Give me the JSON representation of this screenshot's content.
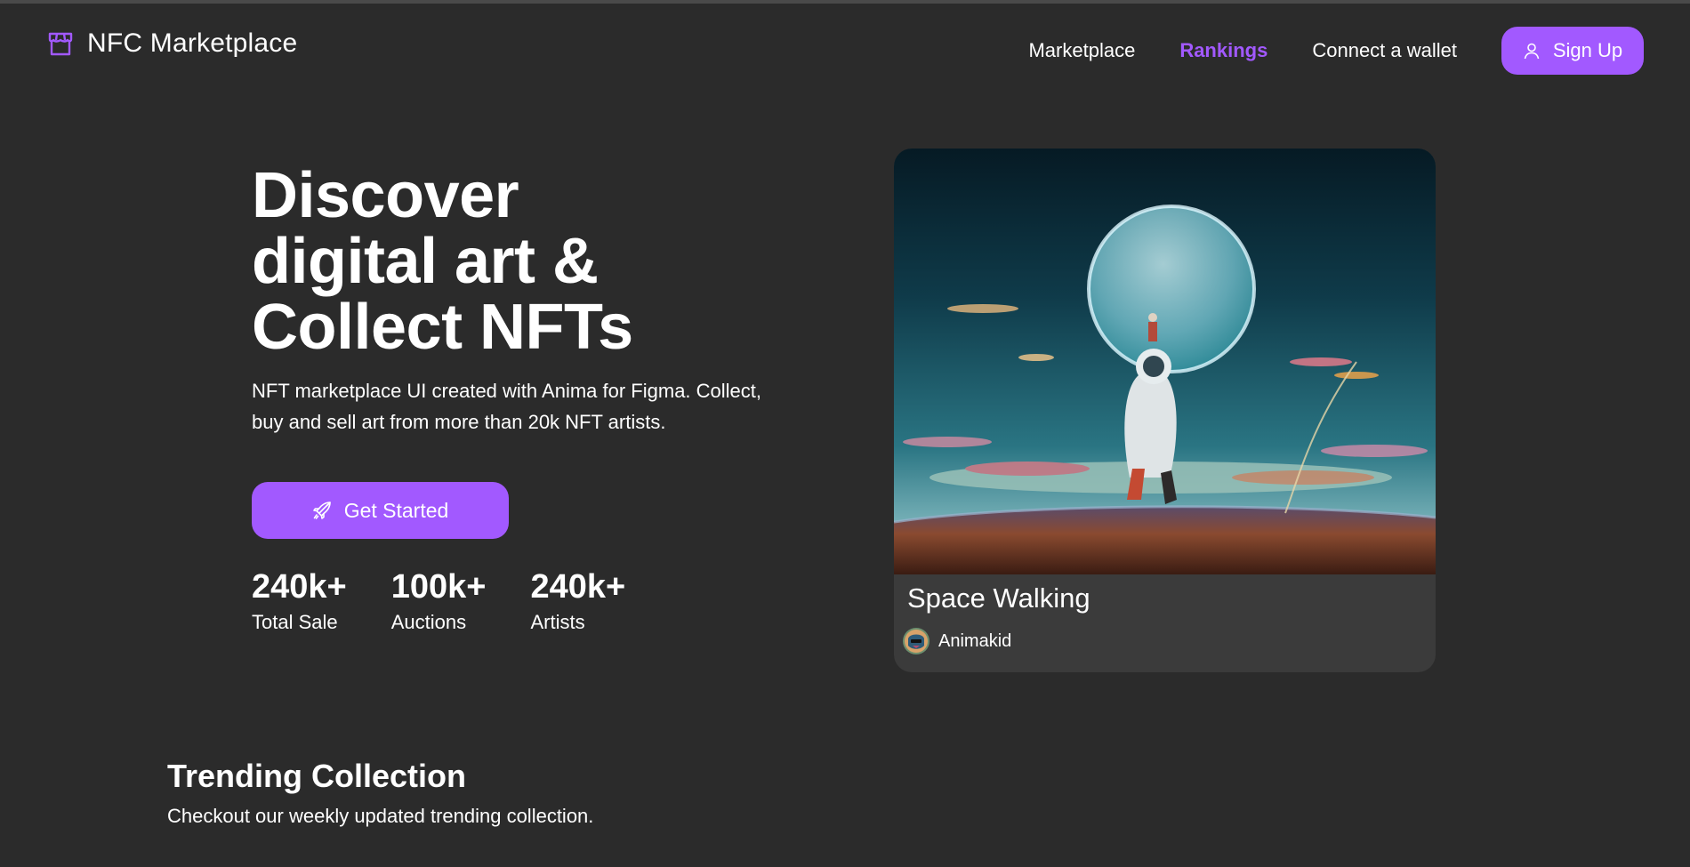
{
  "header": {
    "brand": "NFC Marketplace",
    "nav": [
      {
        "label": "Marketplace",
        "active": false
      },
      {
        "label": "Rankings",
        "active": true
      },
      {
        "label": "Connect a wallet",
        "active": false
      }
    ],
    "signup_label": "Sign Up"
  },
  "hero": {
    "title_lines": [
      "Discover",
      "digital art &",
      "Collect NFTs"
    ],
    "subtitle": "NFT marketplace UI created with Anima for Figma. Collect, buy and sell art from more than 20k NFT artists.",
    "cta_label": "Get Started",
    "stats": [
      {
        "value": "240k+",
        "label": "Total Sale"
      },
      {
        "value": "100k+",
        "label": "Auctions"
      },
      {
        "value": "240k+",
        "label": "Artists"
      }
    ]
  },
  "featured": {
    "title": "Space Walking",
    "artist": "Animakid"
  },
  "trending": {
    "title": "Trending Collection",
    "subtitle": "Checkout our weekly updated trending collection."
  },
  "colors": {
    "accent": "#a259ff",
    "background": "#2b2b2b",
    "card": "#3b3b3b"
  },
  "icons": {
    "logo": "storefront-icon",
    "signup": "user-icon",
    "cta": "rocket-icon"
  }
}
